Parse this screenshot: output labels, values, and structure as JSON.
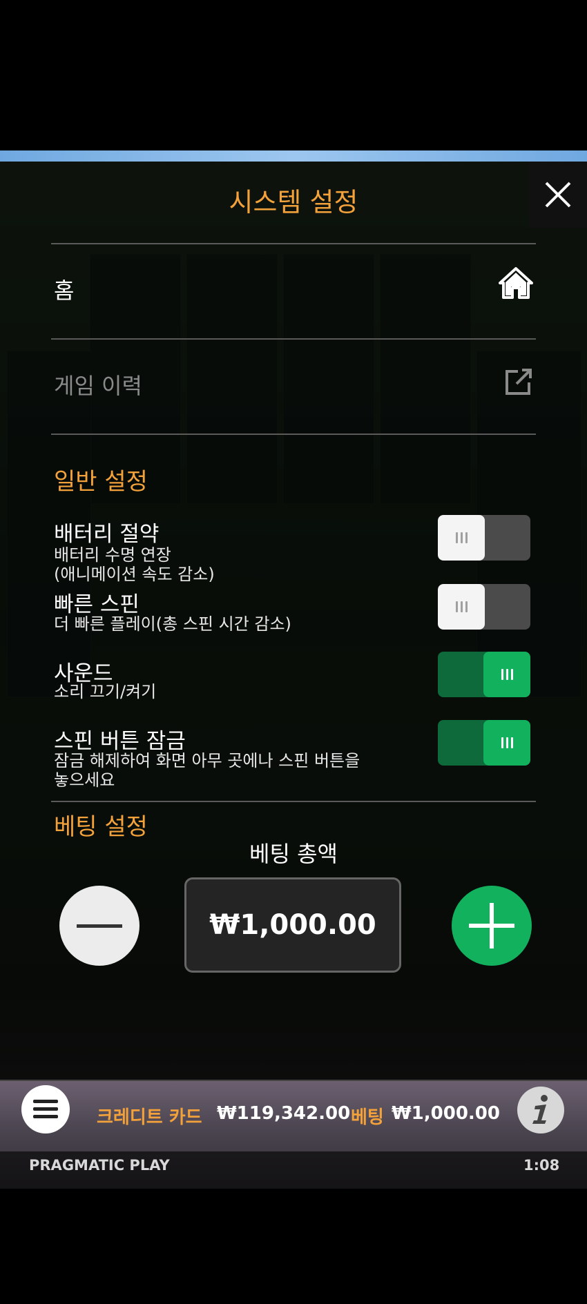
{
  "dialog": {
    "title": "시스템 설정",
    "home_label": "홈",
    "history_label": "게임 이력"
  },
  "general": {
    "section_title": "일반 설정",
    "items": [
      {
        "title": "배터리 절약",
        "desc": "배터리 수명 연장\n(애니메이션 속도 감소)",
        "enabled": false
      },
      {
        "title": "빠른 스핀",
        "desc": "더 빠른 플레이(총 스핀 시간 감소)",
        "enabled": false
      },
      {
        "title": "사운드",
        "desc": "소리 끄기/켜기",
        "enabled": true
      },
      {
        "title": "스핀 버튼 잠금",
        "desc": "잠금 해제하여 화면 아무 곳에나 스핀 버튼을\n놓으세요",
        "enabled": true
      }
    ]
  },
  "betting": {
    "section_title": "베팅 설정",
    "total_label": "베팅 총액",
    "value": "₩1,000.00"
  },
  "footer": {
    "credit_label": "크레디트 카드",
    "credit_value": "₩119,342.00",
    "bet_label": "베팅",
    "bet_value": "₩1,000.00",
    "brand": "PRAGMATIC PLAY",
    "clock": "1:08"
  },
  "icons": {
    "close": "close-icon",
    "home": "home-icon",
    "history": "external-link-icon",
    "minus": "minus-icon",
    "plus": "plus-icon",
    "menu": "menu-icon",
    "info": "info-icon"
  },
  "colors": {
    "accent": "#f3a23b",
    "toggle_on": "#11b15e",
    "toggle_off": "#4b4b4b"
  }
}
